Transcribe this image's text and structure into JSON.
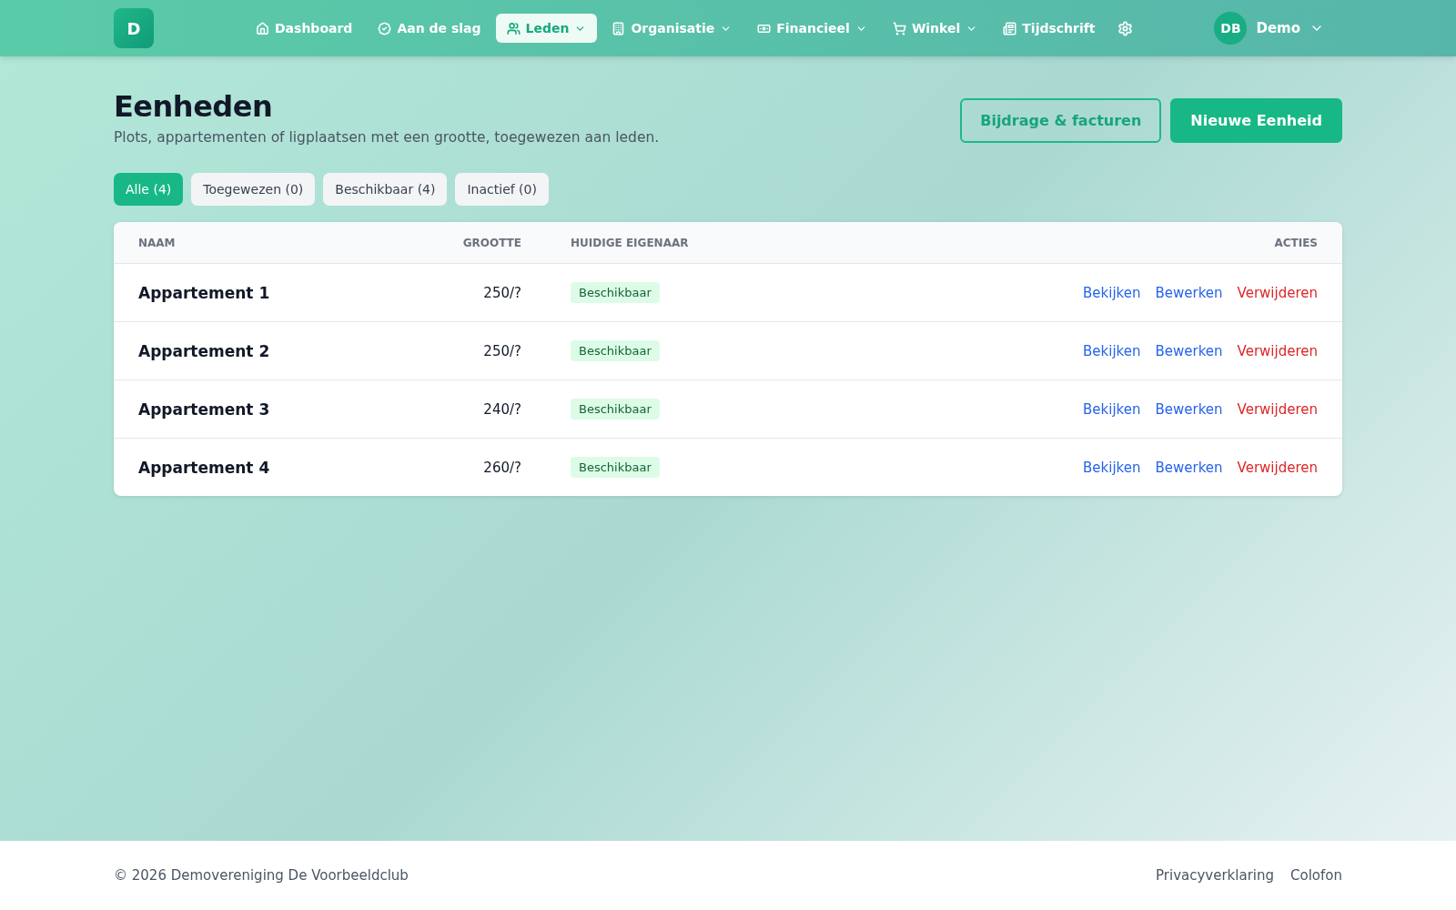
{
  "brand": {
    "letter": "D"
  },
  "nav": [
    {
      "label": "Dashboard",
      "dropdown": false,
      "selected": false
    },
    {
      "label": "Aan de slag",
      "dropdown": false,
      "selected": false
    },
    {
      "label": "Leden",
      "dropdown": true,
      "selected": true
    },
    {
      "label": "Organisatie",
      "dropdown": true,
      "selected": false
    },
    {
      "label": "Financieel",
      "dropdown": true,
      "selected": false
    },
    {
      "label": "Winkel",
      "dropdown": true,
      "selected": false
    },
    {
      "label": "Tijdschrift",
      "dropdown": false,
      "selected": false
    }
  ],
  "user": {
    "initials": "DB",
    "name": "Demo"
  },
  "page": {
    "title": "Eenheden",
    "subtitle": "Plots, appartementen of ligplaatsen met een grootte, toegewezen aan leden.",
    "buttons": [
      {
        "label": "Bijdrage & facturen",
        "kind": "outline"
      },
      {
        "label": "Nieuwe Eenheid",
        "kind": "primary"
      }
    ]
  },
  "filters": [
    {
      "label": "Alle (4)",
      "selected": true
    },
    {
      "label": "Toegewezen (0)",
      "selected": false
    },
    {
      "label": "Beschikbaar (4)",
      "selected": false
    },
    {
      "label": "Inactief (0)",
      "selected": false
    }
  ],
  "table": {
    "columns": [
      "NAAM",
      "GROOTTE",
      "HUIDIGE EIGENAAR",
      "ACTIES"
    ],
    "rows": [
      {
        "name": "Appartement 1",
        "size": "250/?",
        "status": "Beschikbaar",
        "actions": [
          {
            "label": "Bekijken",
            "kind": "link"
          },
          {
            "label": "Bewerken",
            "kind": "link"
          },
          {
            "label": "Verwijderen",
            "kind": "danger"
          }
        ]
      },
      {
        "name": "Appartement 2",
        "size": "250/?",
        "status": "Beschikbaar",
        "actions": [
          {
            "label": "Bekijken",
            "kind": "link"
          },
          {
            "label": "Bewerken",
            "kind": "link"
          },
          {
            "label": "Verwijderen",
            "kind": "danger"
          }
        ]
      },
      {
        "name": "Appartement 3",
        "size": "240/?",
        "status": "Beschikbaar",
        "actions": [
          {
            "label": "Bekijken",
            "kind": "link"
          },
          {
            "label": "Bewerken",
            "kind": "link"
          },
          {
            "label": "Verwijderen",
            "kind": "danger"
          }
        ]
      },
      {
        "name": "Appartement 4",
        "size": "260/?",
        "status": "Beschikbaar",
        "actions": [
          {
            "label": "Bekijken",
            "kind": "link"
          },
          {
            "label": "Bewerken",
            "kind": "link"
          },
          {
            "label": "Verwijderen",
            "kind": "danger"
          }
        ]
      }
    ]
  },
  "footer": {
    "copyright": "© 2026 Demovereniging De Voorbeeldclub",
    "links": [
      "Privacyverklaring",
      "Colofon"
    ]
  }
}
